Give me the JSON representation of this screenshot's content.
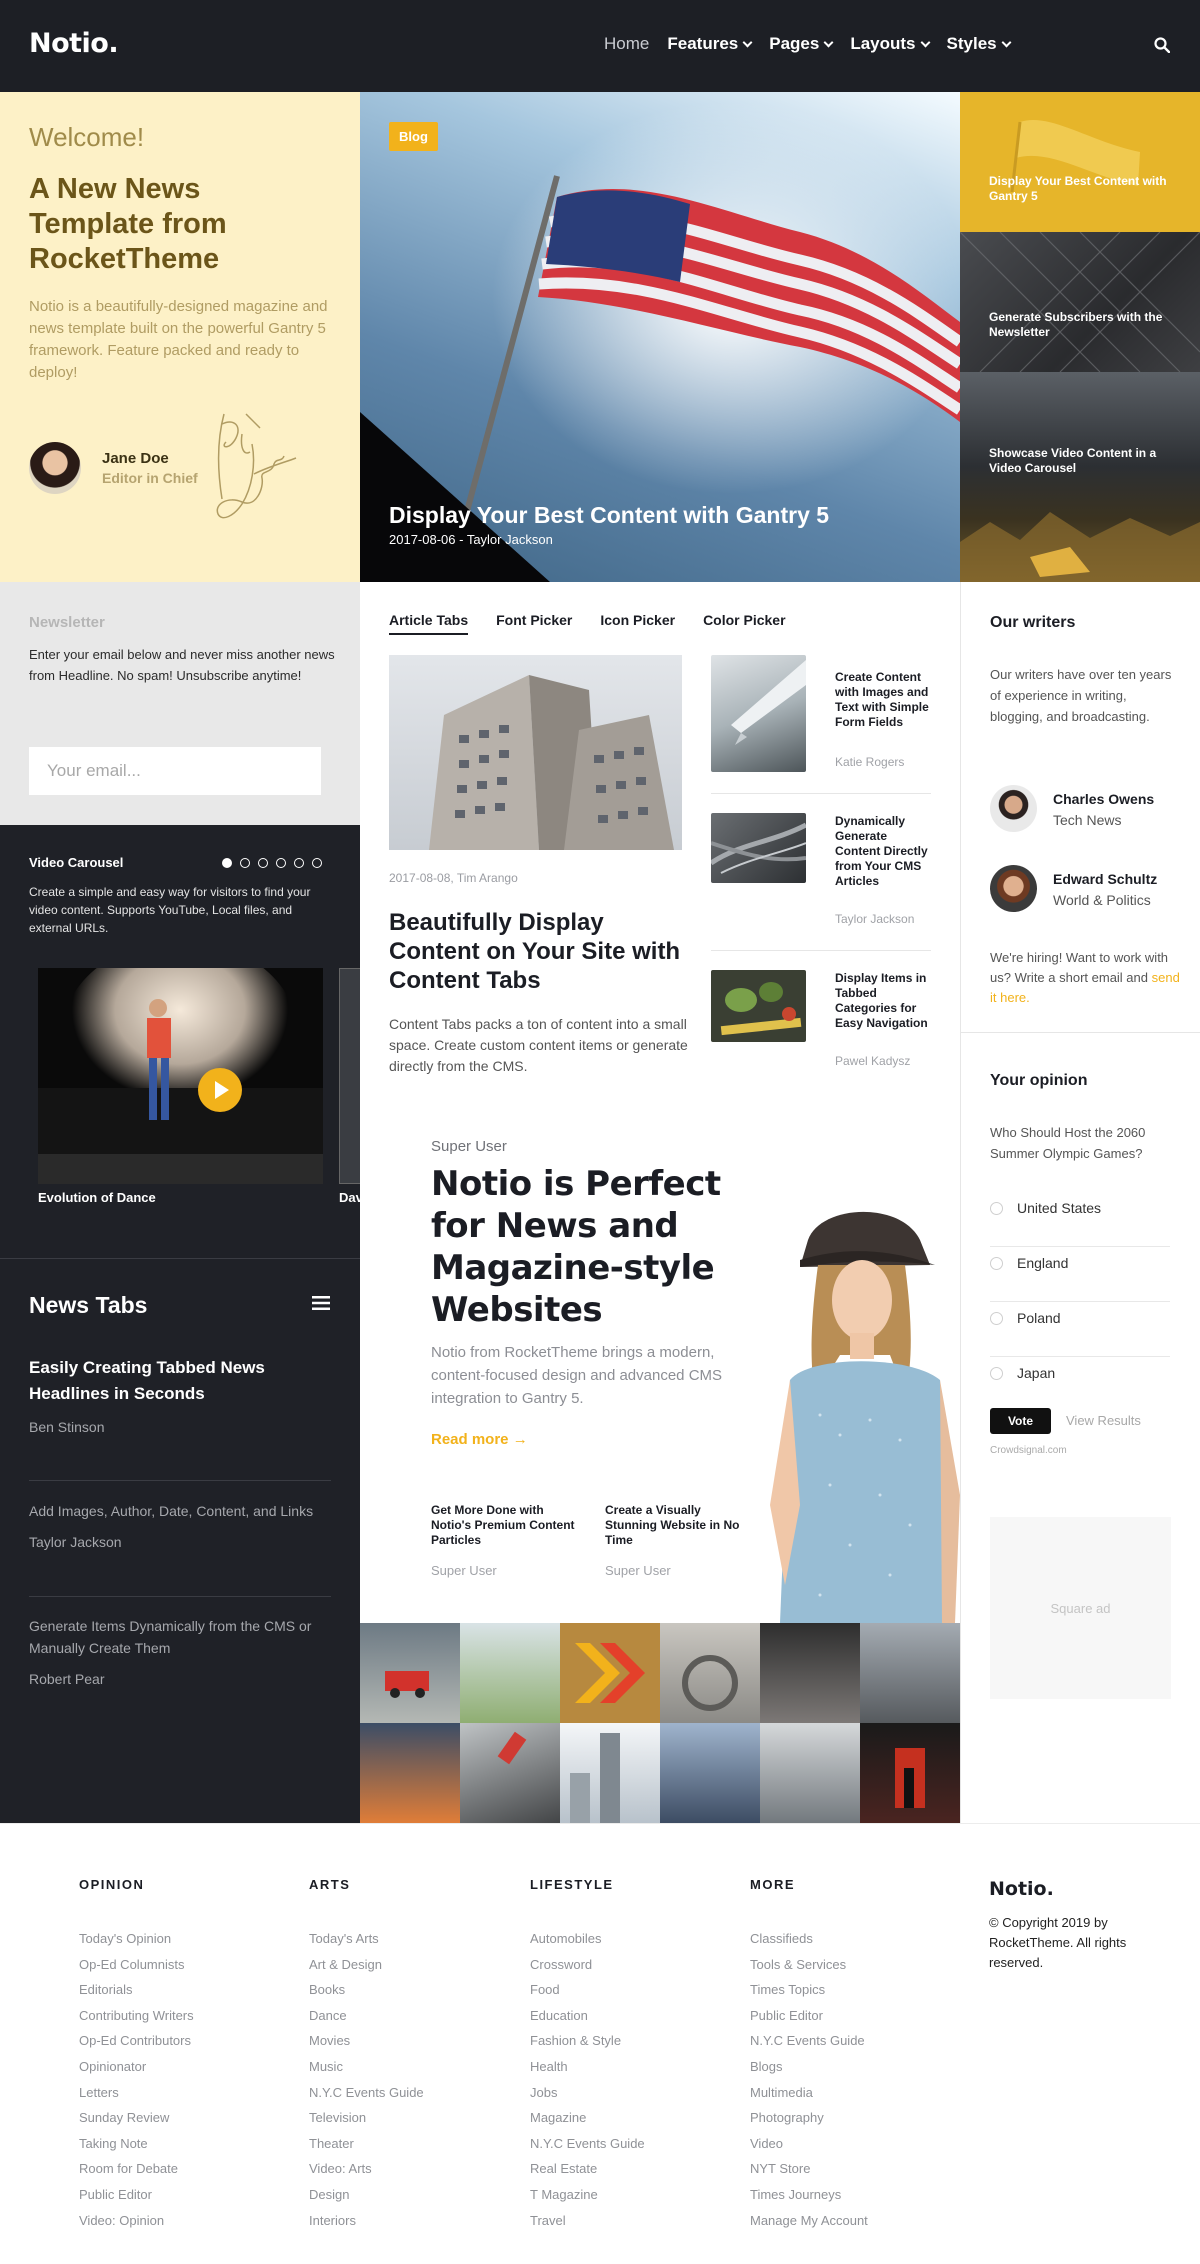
{
  "header": {
    "logo": "Notio.",
    "nav": [
      {
        "label": "Home",
        "has_dropdown": false
      },
      {
        "label": "Features",
        "has_dropdown": true
      },
      {
        "label": "Pages",
        "has_dropdown": true
      },
      {
        "label": "Layouts",
        "has_dropdown": true
      },
      {
        "label": "Styles",
        "has_dropdown": true
      }
    ],
    "search_icon": "search-icon"
  },
  "welcome": {
    "greeting": "Welcome!",
    "title": "A New News Template from RocketTheme",
    "description": "Notio is a beautifully-designed magazine and news template built on the powerful Gantry 5 framework. Feature packed and ready to deploy!",
    "author": "Jane Doe",
    "role": "Editor in Chief"
  },
  "hero": {
    "tag": "Blog",
    "title": "Display Your Best Content with Gantry 5",
    "meta": "2017-08-06 - Taylor Jackson"
  },
  "side_cards": [
    {
      "title": "Display Your Best Content with Gantry 5"
    },
    {
      "title": "Generate Subscribers with the Newsletter"
    },
    {
      "title": "Showcase Video Content in a Video Carousel"
    }
  ],
  "newsletter": {
    "title": "Newsletter",
    "text": "Enter your email below and never miss another news from Headline. No spam! Unsubscribe anytime!",
    "placeholder": "Your email..."
  },
  "video_carousel": {
    "title": "Video Carousel",
    "description": "Create a simple and easy way for visitors to find your video content. Supports YouTube, Local files, and external URLs.",
    "caption": "Evolution of Dance",
    "caption_next": "Dav",
    "dots": 6,
    "active_dot": 1
  },
  "news_tabs": {
    "title": "News Tabs",
    "items": [
      {
        "title": "Easily Creating Tabbed News Headlines in Seconds",
        "author": "Ben Stinson",
        "featured": true
      },
      {
        "title": "Add Images, Author, Date, Content, and Links",
        "author": "Taylor Jackson",
        "featured": false
      },
      {
        "title": "Generate Items Dynamically from the CMS or Manually Create Them",
        "author": "Robert Pear",
        "featured": false
      }
    ]
  },
  "article_tabs": {
    "tabs": [
      "Article Tabs",
      "Font Picker",
      "Icon Picker",
      "Color Picker"
    ],
    "active": 0,
    "main": {
      "meta": "2017-08-08, Tim Arango",
      "title": "Beautifully Display Content on Your Site with Content Tabs",
      "description": "Content Tabs packs a ton of content into a small space. Create custom content items or generate directly from the CMS."
    },
    "list": [
      {
        "title": "Create Content with Images and Text with Simple Form Fields",
        "author": "Katie Rogers"
      },
      {
        "title": "Dynamically Generate Content Directly from Your CMS Articles",
        "author": "Taylor Jackson"
      },
      {
        "title": "Display Items in Tabbed Categories for Easy Navigation",
        "author": "Pawel Kadysz"
      }
    ]
  },
  "promo": {
    "author": "Super User",
    "title": "Notio is Perfect for News and Magazine-style Websites",
    "description": "Notio from RocketTheme brings a modern, content-focused design and advanced CMS integration to Gantry 5.",
    "read_more": "Read more →",
    "particles": [
      {
        "title": "Get More Done with Notio's Premium Content Particles",
        "author": "Super User"
      },
      {
        "title": "Create a Visually Stunning Website in No Time",
        "author": "Super User"
      }
    ]
  },
  "writers": {
    "title": "Our writers",
    "description": "Our writers have over ten years of experience in writing, blogging, and broadcasting.",
    "list": [
      {
        "name": "Charles Owens",
        "section": "Tech News"
      },
      {
        "name": "Edward Schultz",
        "section": "World & Politics"
      }
    ],
    "hiring": "We're hiring! Want to work with us? Write a short email and",
    "hiring_link": "send it here."
  },
  "opinion": {
    "title": "Your opinion",
    "question": "Who Should Host the 2060 Summer Olympic Games?",
    "options": [
      "United States",
      "England",
      "Poland",
      "Japan"
    ],
    "vote": "Vote",
    "view_results": "View Results",
    "provider": "Crowdsignal.com",
    "ad": "Square ad"
  },
  "footer": {
    "columns": [
      {
        "title": "OPINION",
        "links": [
          "Today's Opinion",
          "Op-Ed Columnists",
          "Editorials",
          "Contributing Writers",
          "Op-Ed Contributors",
          "Opinionator",
          "Letters",
          "Sunday Review",
          "Taking Note",
          "Room for Debate",
          "Public Editor",
          "Video: Opinion"
        ]
      },
      {
        "title": "ARTS",
        "links": [
          "Today's Arts",
          "Art & Design",
          "Books",
          "Dance",
          "Movies",
          "Music",
          "N.Y.C Events Guide",
          "Television",
          "Theater",
          "Video: Arts",
          "Design",
          "Interiors"
        ]
      },
      {
        "title": "LIFESTYLE",
        "links": [
          "Automobiles",
          "Crossword",
          "Food",
          "Education",
          "Fashion & Style",
          "Health",
          "Jobs",
          "Magazine",
          "N.Y.C Events Guide",
          "Real Estate",
          "T Magazine",
          "Travel"
        ]
      },
      {
        "title": "MORE",
        "links": [
          "Classifieds",
          "Tools & Services",
          "Times Topics",
          "Public Editor",
          "N.Y.C Events Guide",
          "Blogs",
          "Multimedia",
          "Photography",
          "Video",
          "NYT Store",
          "Times Journeys",
          "Manage My Account"
        ]
      }
    ],
    "logo": "Notio.",
    "copyright": "© Copyright 2019 by RocketTheme. All rights reserved."
  },
  "colors": {
    "accent": "#f2b21b",
    "dark": "#1f2127",
    "header": "#1d1f25",
    "welcome_bg": "#fdf1c7"
  }
}
